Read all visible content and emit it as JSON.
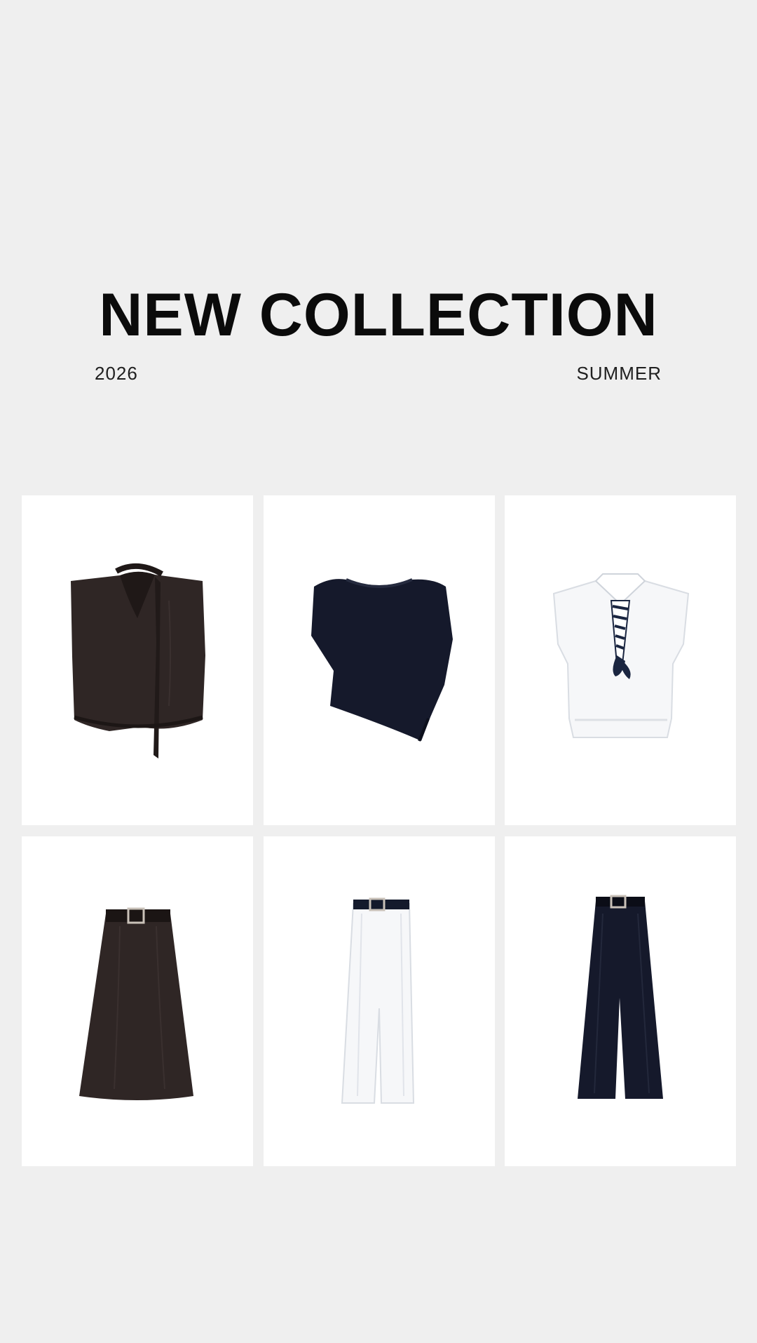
{
  "hero": {
    "title": "NEW COLLECTION",
    "year": "2026",
    "season": "SUMMER"
  },
  "colors": {
    "background": "#efefef",
    "card": "#ffffff",
    "text": "#0b0b0b",
    "brown": "#2f2625",
    "navy": "#15192b",
    "white_garment": "#f6f7f9"
  },
  "products": [
    {
      "item": "brown sleeveless top with neck tie",
      "icon": "brown-sleeveless-top-icon"
    },
    {
      "item": "navy asymmetric knit top",
      "icon": "navy-knit-top-icon"
    },
    {
      "item": "white sleeveless polo with scarf",
      "icon": "white-polo-top-icon"
    },
    {
      "item": "brown belted midi skirt",
      "icon": "brown-skirt-icon"
    },
    {
      "item": "white belted wide trousers",
      "icon": "white-trousers-icon"
    },
    {
      "item": "navy belted wide trousers",
      "icon": "navy-trousers-icon"
    }
  ]
}
